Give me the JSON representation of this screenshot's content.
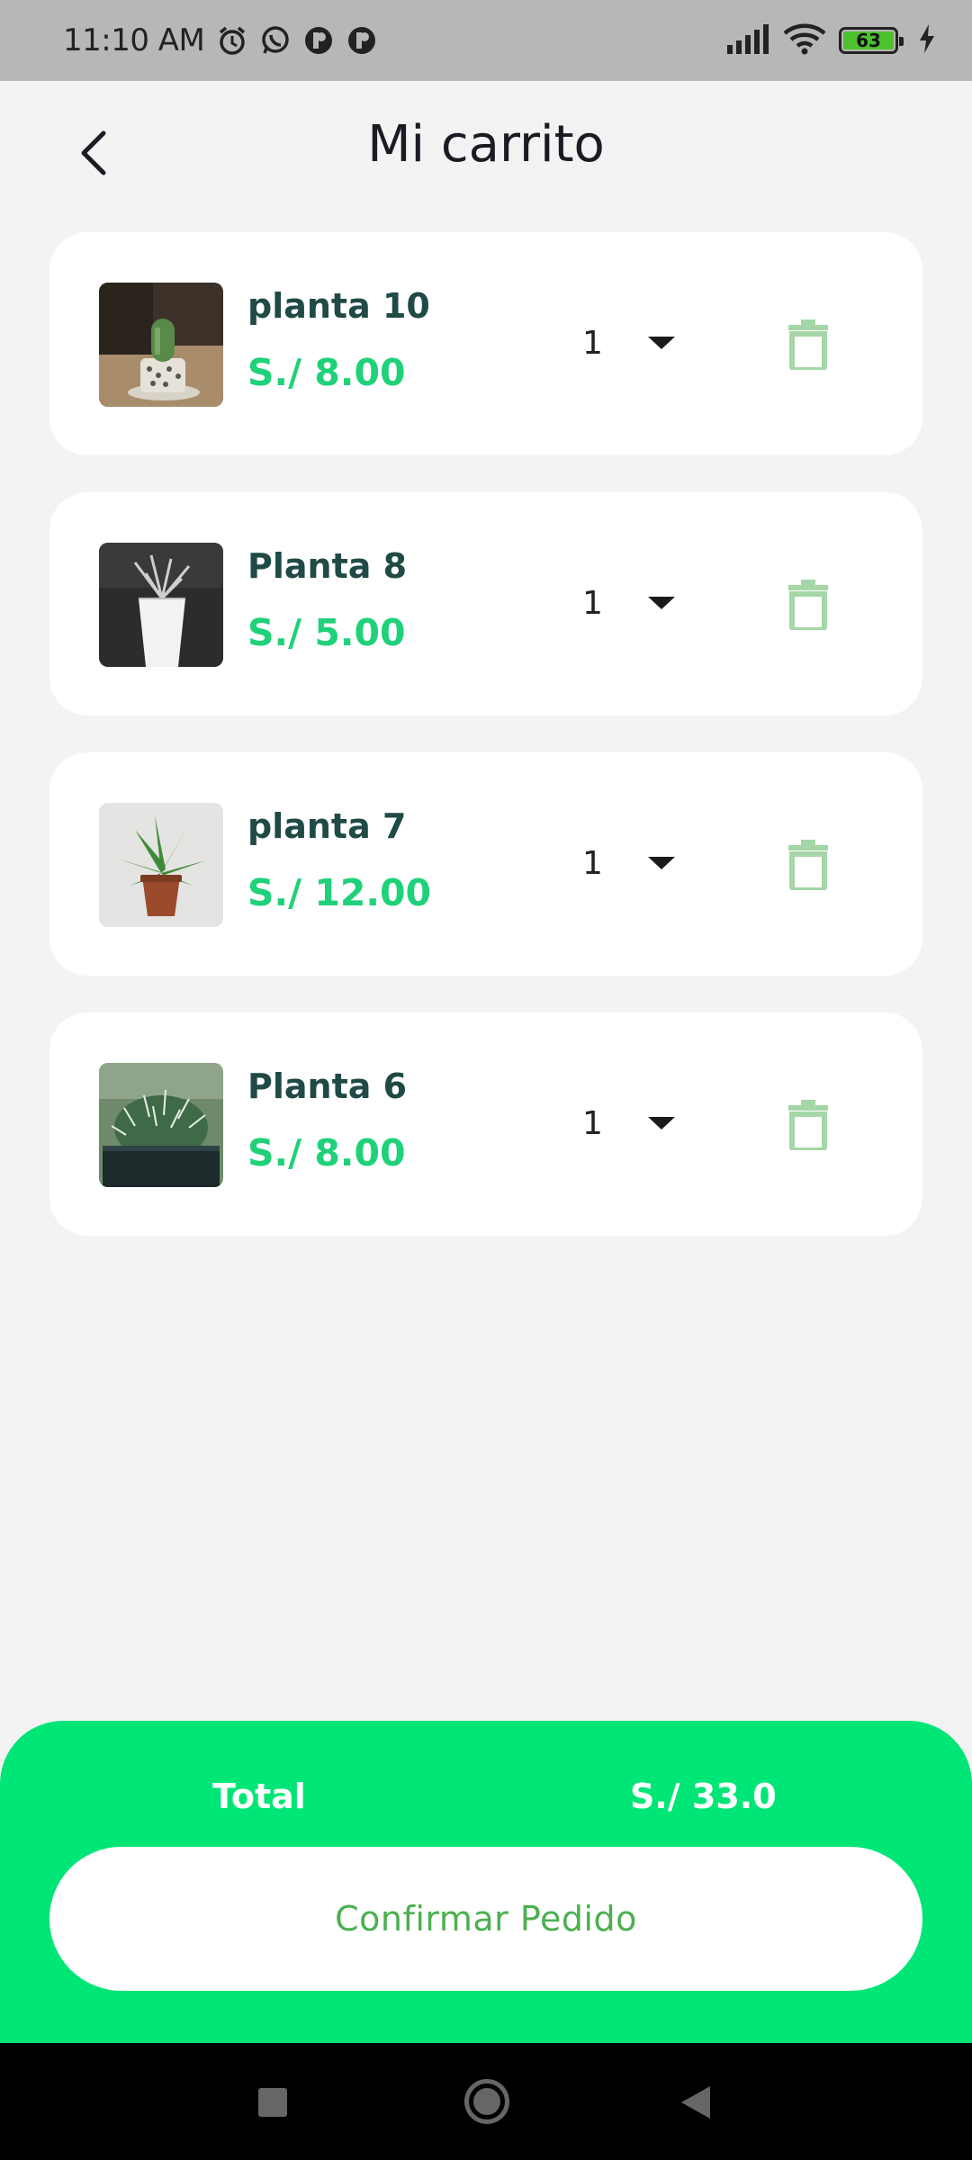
{
  "status_bar": {
    "time": "11:10 AM",
    "battery_level": "63",
    "icons_left": [
      "alarm-icon",
      "whatsapp-icon",
      "app-notification-icon",
      "app-notification-icon"
    ],
    "icons_right": [
      "signal-icon",
      "wifi-icon",
      "battery-icon",
      "charging-icon"
    ]
  },
  "header": {
    "title": "Mi carrito",
    "back_icon": "chevron-left-icon"
  },
  "cart": {
    "items": [
      {
        "name": "planta 10",
        "price": "S./ 8.00",
        "quantity": "1",
        "image": "potted-cactus-on-table"
      },
      {
        "name": "Planta 8",
        "price": "S./ 5.00",
        "quantity": "1",
        "image": "succulent-in-white-pot"
      },
      {
        "name": "planta 7",
        "price": "S./ 12.00",
        "quantity": "1",
        "image": "aloe-in-terracotta-pot"
      },
      {
        "name": "Planta 6",
        "price": "S./ 8.00",
        "quantity": "1",
        "image": "spiky-cactus-in-planter"
      }
    ]
  },
  "summary": {
    "total_label": "Total",
    "total_value": "S./ 33.0",
    "confirm_label": "Confirmar Pedido"
  },
  "colors": {
    "accent": "#00e676",
    "price": "#1fd179",
    "name": "#1f4a45",
    "delete_icon": "#a5d6a7",
    "confirm_text": "#4caf50"
  }
}
